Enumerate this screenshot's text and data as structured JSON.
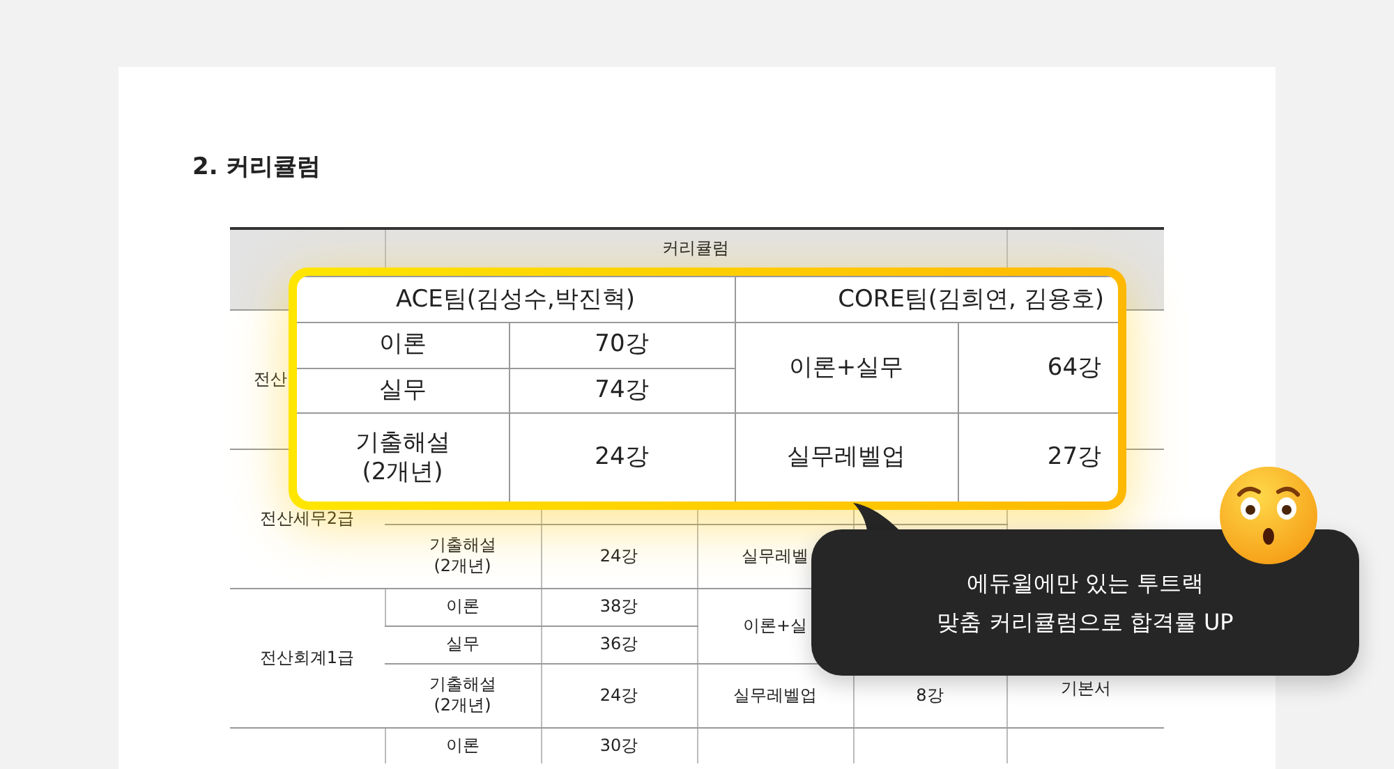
{
  "document": {
    "title": "2.  커리큘럼",
    "table": {
      "header": "커리큘럼",
      "groups": [
        {
          "exam": "전산"
        },
        {
          "exam": "전산세무2급",
          "ace": {
            "row_3": {
              "topic": "기출해설\n(2개년)",
              "count": "24강"
            }
          },
          "core": {
            "lower": {
              "label": "실무레벨"
            }
          }
        },
        {
          "exam": "전산회계1급",
          "ace": {
            "row_1": {
              "topic": "이론",
              "count": "38강"
            },
            "row_2": {
              "topic": "실무",
              "count": "36강"
            },
            "row_3": {
              "topic": "기출해설\n(2개년)",
              "count": "24강"
            }
          },
          "core": {
            "upper": {
              "label": "이론+실"
            },
            "lower": {
              "label": "실무레벨업",
              "count": "8강"
            }
          },
          "book": "기본서"
        },
        {
          "ace": {
            "row_1": {
              "topic": "이론",
              "count": "30강"
            }
          }
        }
      ]
    }
  },
  "callout": {
    "headers": [
      "ACE팀(김성수,박진혁)",
      "CORE팀(김희연, 김용호)"
    ],
    "groups": [
      {
        "ace": [
          {
            "topic": "이론",
            "count": "70강"
          },
          {
            "topic": "실무",
            "count": "74강"
          }
        ],
        "core": {
          "label": "이론+실무",
          "count": "64강"
        }
      },
      {
        "ace": [
          {
            "topic": "기출해설\n(2개년)",
            "count": "24강"
          }
        ],
        "core": {
          "label": "실무레벨업",
          "count": "27강"
        }
      }
    ]
  },
  "bubble": {
    "text": "에듀윌에만 있는 투트랙\n맞춤 커리큘럼으로 합격률 UP"
  }
}
